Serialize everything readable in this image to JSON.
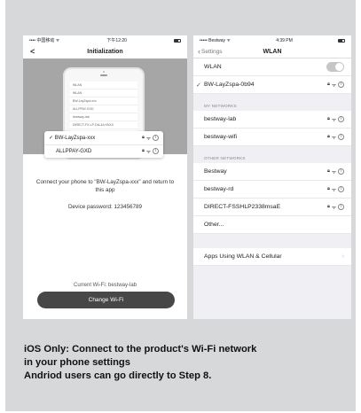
{
  "left_phone": {
    "status_bar": {
      "carrier": "•••• 中国移动 ᯤ",
      "time": "下午12:20"
    },
    "title": "Initialization",
    "mini_screen": {
      "header": "WLAN",
      "rows": [
        "WLAN",
        "BW-LayZspa-xxx",
        "ALLPPAY-GXD",
        "bestway-lab",
        "DIRECT-FX-LP-D4L4A KNXX"
      ]
    },
    "popup": {
      "network_1": "BW-LayZspa-xxx",
      "network_2": "ALLPPAY-GXD"
    },
    "instruction": "Connect your phone to \"BW-LayZspa-xxx\" and return to this app",
    "password_label": "Device password:",
    "password_value": "123456789",
    "current_wifi": "Current Wi-Fi: bestway-lab",
    "change_button": "Change Wi-Fi"
  },
  "right_phone": {
    "status_bar": {
      "carrier": "••••• Bestway ᯤ",
      "time": "4:39 PM"
    },
    "back_label": "Settings",
    "title": "WLAN",
    "wlan_label": "WLAN",
    "connected_network": "BW-LayZspa-0b94",
    "my_networks_header": "MY NETWORKS",
    "my_networks": [
      "bestway-lab",
      "bestway-wifi"
    ],
    "other_networks_header": "OTHER NETWORKS",
    "other_networks": [
      "Bestway",
      "bestway-rd",
      "DIRECT-FSSHLP2338msaE"
    ],
    "other_label": "Other...",
    "apps_label": "Apps Using WLAN & Cellular"
  },
  "caption": {
    "line1": "iOS Only: Connect to the product's Wi-Fi network",
    "line2": "in your phone settings",
    "line3": "Andriod users can go directly to Step 8."
  },
  "icons": [
    "back-chevron-icon",
    "battery-icon",
    "wifi-icon",
    "lock-icon",
    "info-icon",
    "checkmark-icon",
    "toggle-switch",
    "chevron-right-icon"
  ]
}
